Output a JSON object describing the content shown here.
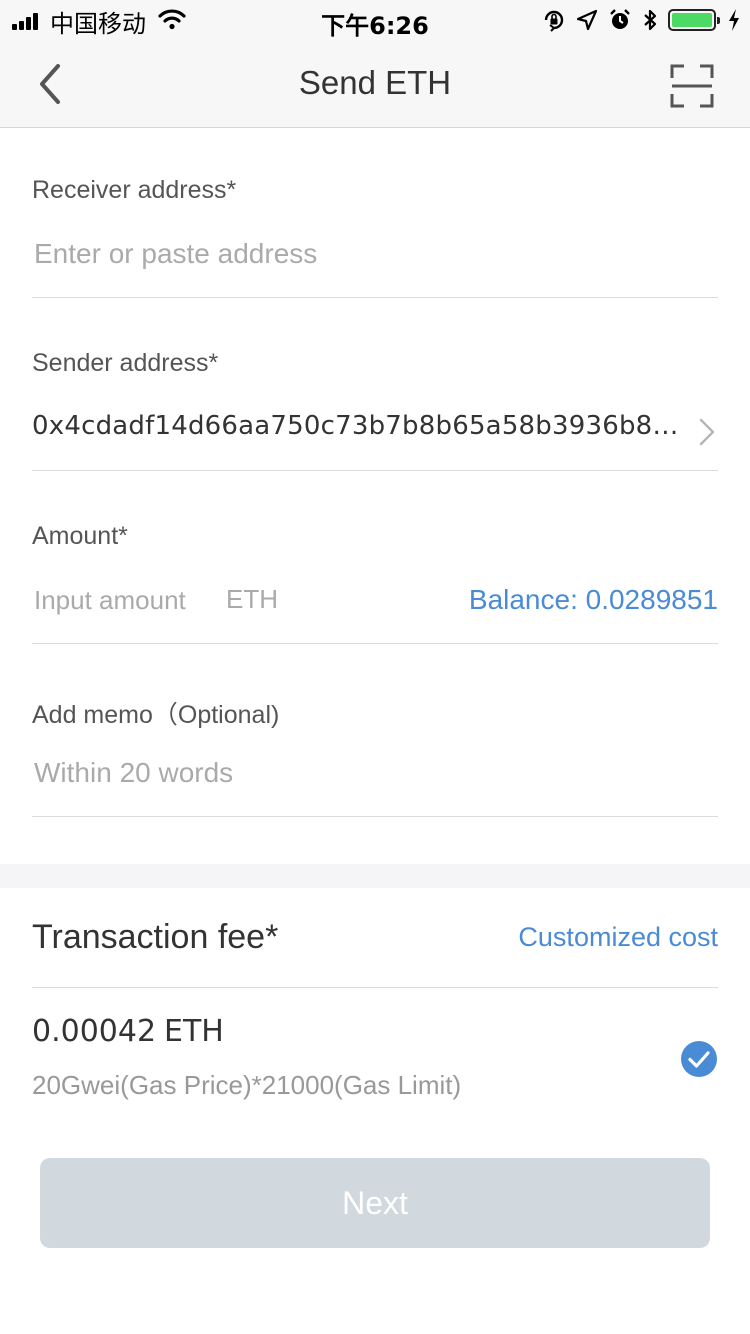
{
  "status_bar": {
    "carrier": "中国移动",
    "time": "下午6:26"
  },
  "nav": {
    "title": "Send ETH",
    "back_icon": "chevron-left-icon",
    "scan_icon": "scan-icon"
  },
  "receiver": {
    "label": "Receiver address*",
    "placeholder": "Enter or paste address"
  },
  "sender": {
    "label": "Sender address*",
    "value": "0x4cdadf14d66aa750c73b7b8b65a58b3936b8…"
  },
  "amount": {
    "label": "Amount*",
    "placeholder": "Input amount",
    "unit": "ETH",
    "balance": "Balance: 0.0289851"
  },
  "memo": {
    "label": "Add memo（Optional)",
    "placeholder": "Within 20 words"
  },
  "fee": {
    "title": "Transaction fee*",
    "custom_label": "Customized cost",
    "option": {
      "amount": "0.00042",
      "unit": "ETH",
      "detail": "20Gwei(Gas Price)*21000(Gas Limit)",
      "selected": true
    }
  },
  "actions": {
    "next_label": "Next",
    "next_enabled": false
  },
  "colors": {
    "accent": "#4a8bd6",
    "disabled_button": "#d2d9de",
    "battery": "#4cd964"
  }
}
